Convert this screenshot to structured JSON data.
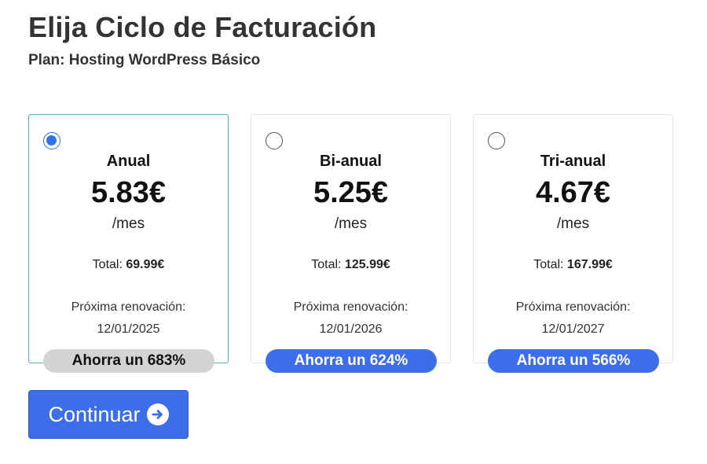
{
  "header": {
    "title": "Elija Ciclo de Facturación",
    "plan": "Plan: Hosting WordPress Básico"
  },
  "cycles": [
    {
      "name": "Anual",
      "price": "5.83€",
      "per": "/mes",
      "total_label": "Total:",
      "total_value": "69.99€",
      "renew_label": "Próxima renovación:",
      "renew_date": "12/01/2025",
      "savings": "Ahorra un 683%",
      "selected": true
    },
    {
      "name": "Bi-anual",
      "price": "5.25€",
      "per": "/mes",
      "total_label": "Total:",
      "total_value": "125.99€",
      "renew_label": "Próxima renovación:",
      "renew_date": "12/01/2026",
      "savings": "Ahorra un 624%",
      "selected": false
    },
    {
      "name": "Tri-anual",
      "price": "4.67€",
      "per": "/mes",
      "total_label": "Total:",
      "total_value": "167.99€",
      "renew_label": "Próxima renovación:",
      "renew_date": "12/01/2027",
      "savings": "Ahorra un 566%",
      "selected": false
    }
  ],
  "actions": {
    "continue_label": "Continuar",
    "continue_icon": "arrow-right-circle-icon"
  },
  "colors": {
    "accent": "#3b6ee8",
    "selected_border": "#5aa9d6",
    "badge_inactive": "#d4d4d4"
  }
}
